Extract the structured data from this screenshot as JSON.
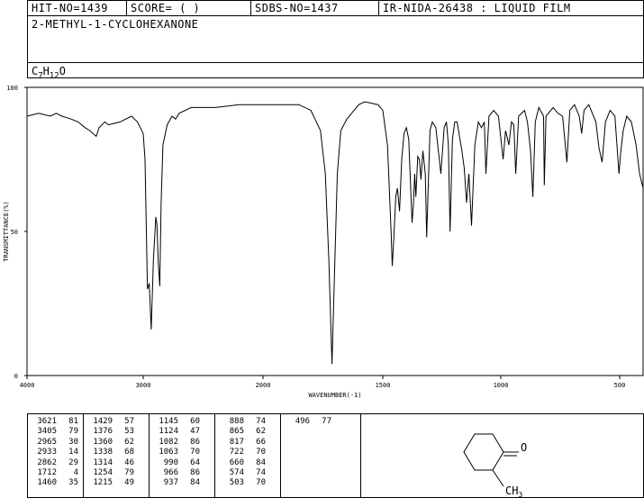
{
  "header": {
    "hit_no": "HIT-NO=1439",
    "score": "SCORE=  (   )",
    "sdbs_no": "SDBS-NO=1437",
    "ir_info": "IR-NIDA-26438 : LIQUID FILM"
  },
  "compound": {
    "name": "2-METHYL-1-CYCLOHEXANONE",
    "formula": {
      "c": "C",
      "c_n": "7",
      "h": "H",
      "h_n": "12",
      "o": "O"
    }
  },
  "chart_data": {
    "type": "line",
    "xlabel": "WAVENUMBER(-1)",
    "ylabel": "TRANSMITTANCE(%)",
    "xlim": [
      4000,
      400
    ],
    "ylim": [
      0,
      100
    ],
    "x_reversed": true,
    "xticks": [
      "4000",
      "3000",
      "2000",
      "1500",
      "1000",
      "500"
    ],
    "xtick_values": [
      4000,
      3000,
      2000,
      1500,
      1000,
      500
    ],
    "yticks": [
      "0",
      "50",
      "100"
    ],
    "ytick_values": [
      0,
      50,
      100
    ],
    "series": [
      {
        "points": [
          [
            4000,
            90
          ],
          [
            3900,
            91
          ],
          [
            3800,
            90
          ],
          [
            3750,
            91
          ],
          [
            3700,
            90
          ],
          [
            3621,
            89
          ],
          [
            3560,
            88
          ],
          [
            3500,
            86
          ],
          [
            3460,
            85
          ],
          [
            3405,
            83
          ],
          [
            3380,
            86
          ],
          [
            3330,
            88
          ],
          [
            3300,
            87
          ],
          [
            3200,
            88
          ],
          [
            3100,
            90
          ],
          [
            3050,
            88
          ],
          [
            3000,
            84
          ],
          [
            2985,
            75
          ],
          [
            2965,
            30
          ],
          [
            2950,
            32
          ],
          [
            2933,
            16
          ],
          [
            2915,
            40
          ],
          [
            2895,
            55
          ],
          [
            2885,
            52
          ],
          [
            2875,
            40
          ],
          [
            2862,
            31
          ],
          [
            2850,
            60
          ],
          [
            2835,
            80
          ],
          [
            2800,
            87
          ],
          [
            2760,
            90
          ],
          [
            2730,
            89
          ],
          [
            2700,
            91
          ],
          [
            2600,
            93
          ],
          [
            2400,
            93
          ],
          [
            2200,
            94
          ],
          [
            2000,
            94
          ],
          [
            1900,
            94
          ],
          [
            1850,
            94
          ],
          [
            1800,
            92
          ],
          [
            1760,
            85
          ],
          [
            1740,
            70
          ],
          [
            1725,
            40
          ],
          [
            1712,
            4
          ],
          [
            1700,
            40
          ],
          [
            1690,
            70
          ],
          [
            1675,
            85
          ],
          [
            1650,
            89
          ],
          [
            1600,
            94
          ],
          [
            1575,
            95
          ],
          [
            1520,
            94
          ],
          [
            1500,
            92
          ],
          [
            1480,
            80
          ],
          [
            1465,
            50
          ],
          [
            1460,
            38
          ],
          [
            1455,
            45
          ],
          [
            1445,
            62
          ],
          [
            1438,
            65
          ],
          [
            1429,
            57
          ],
          [
            1420,
            75
          ],
          [
            1410,
            84
          ],
          [
            1400,
            86
          ],
          [
            1390,
            82
          ],
          [
            1376,
            53
          ],
          [
            1370,
            60
          ],
          [
            1365,
            70
          ],
          [
            1360,
            62
          ],
          [
            1352,
            76
          ],
          [
            1345,
            75
          ],
          [
            1338,
            68
          ],
          [
            1330,
            78
          ],
          [
            1320,
            70
          ],
          [
            1314,
            48
          ],
          [
            1300,
            85
          ],
          [
            1290,
            88
          ],
          [
            1275,
            86
          ],
          [
            1266,
            79
          ],
          [
            1254,
            70
          ],
          [
            1240,
            86
          ],
          [
            1230,
            88
          ],
          [
            1222,
            80
          ],
          [
            1215,
            50
          ],
          [
            1205,
            82
          ],
          [
            1195,
            88
          ],
          [
            1185,
            88
          ],
          [
            1165,
            78
          ],
          [
            1155,
            72
          ],
          [
            1145,
            60
          ],
          [
            1135,
            70
          ],
          [
            1124,
            52
          ],
          [
            1110,
            80
          ],
          [
            1095,
            88
          ],
          [
            1082,
            86
          ],
          [
            1070,
            88
          ],
          [
            1063,
            70
          ],
          [
            1050,
            90
          ],
          [
            1030,
            92
          ],
          [
            1010,
            90
          ],
          [
            990,
            75
          ],
          [
            980,
            85
          ],
          [
            966,
            80
          ],
          [
            955,
            88
          ],
          [
            945,
            87
          ],
          [
            937,
            70
          ],
          [
            925,
            90
          ],
          [
            900,
            92
          ],
          [
            888,
            88
          ],
          [
            875,
            78
          ],
          [
            865,
            62
          ],
          [
            855,
            88
          ],
          [
            840,
            93
          ],
          [
            820,
            90
          ],
          [
            817,
            66
          ],
          [
            810,
            90
          ],
          [
            780,
            93
          ],
          [
            760,
            91
          ],
          [
            740,
            90
          ],
          [
            722,
            74
          ],
          [
            710,
            92
          ],
          [
            690,
            94
          ],
          [
            670,
            90
          ],
          [
            660,
            84
          ],
          [
            650,
            92
          ],
          [
            630,
            94
          ],
          [
            600,
            88
          ],
          [
            587,
            79
          ],
          [
            574,
            74
          ],
          [
            560,
            88
          ],
          [
            540,
            92
          ],
          [
            520,
            90
          ],
          [
            503,
            70
          ],
          [
            496,
            77
          ],
          [
            485,
            85
          ],
          [
            470,
            90
          ],
          [
            450,
            88
          ],
          [
            430,
            80
          ],
          [
            415,
            70
          ],
          [
            400,
            65
          ]
        ]
      }
    ]
  },
  "peaks": [
    [
      [
        "3621",
        "81"
      ],
      [
        "3405",
        "79"
      ],
      [
        "2965",
        "30"
      ],
      [
        "2933",
        "14"
      ],
      [
        "2862",
        "29"
      ],
      [
        "1712",
        "4"
      ],
      [
        "1460",
        "35"
      ]
    ],
    [
      [
        "1429",
        "57"
      ],
      [
        "1376",
        "53"
      ],
      [
        "1360",
        "62"
      ],
      [
        "1338",
        "68"
      ],
      [
        "1314",
        "46"
      ],
      [
        "1254",
        "79"
      ],
      [
        "1215",
        "49"
      ]
    ],
    [
      [
        "1145",
        "60"
      ],
      [
        "1124",
        "47"
      ],
      [
        "1082",
        "86"
      ],
      [
        "1063",
        "70"
      ],
      [
        "990",
        "64"
      ],
      [
        "966",
        "86"
      ],
      [
        "937",
        "84"
      ]
    ],
    [
      [
        "888",
        "74"
      ],
      [
        "865",
        "62"
      ],
      [
        "817",
        "66"
      ],
      [
        "722",
        "70"
      ],
      [
        "660",
        "84"
      ],
      [
        "574",
        "74"
      ],
      [
        "503",
        "70"
      ]
    ],
    [
      [
        "496",
        "77"
      ]
    ]
  ],
  "structure": {
    "oxygen_label": "O",
    "methyl_label": "CH",
    "methyl_sub": "3"
  }
}
